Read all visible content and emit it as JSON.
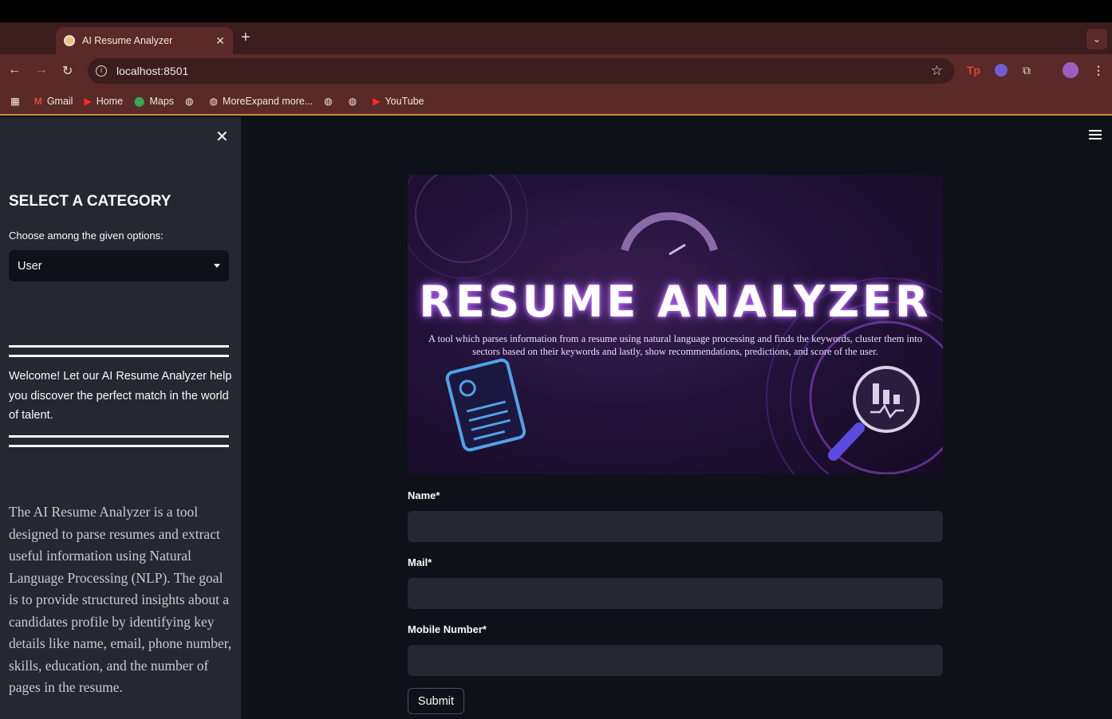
{
  "browser": {
    "tab_title": "AI Resume Analyzer",
    "url": "localhost:8501",
    "bookmarks": [
      {
        "label": "Gmail",
        "icon": "gmail-icon"
      },
      {
        "label": "Home",
        "icon": "youtube-icon"
      },
      {
        "label": "Maps",
        "icon": "maps-icon"
      },
      {
        "label": "",
        "icon": "globe-icon"
      },
      {
        "label": "MoreExpand more...",
        "icon": "globe-icon"
      },
      {
        "label": "",
        "icon": "globe-icon"
      },
      {
        "label": "",
        "icon": "globe-icon"
      },
      {
        "label": "YouTube",
        "icon": "youtube-icon"
      }
    ]
  },
  "sidebar": {
    "heading": "SELECT A CATEGORY",
    "choose_label": "Choose among the given options:",
    "selected_option": "User",
    "welcome_text": "Welcome! Let our AI Resume Analyzer help you discover the perfect match in the world of talent.",
    "about_text": "The AI Resume Analyzer is a tool designed to parse resumes and extract useful information using Natural Language Processing (NLP). The goal is to provide structured insights about a candidates profile by identifying key details like name, email, phone number, skills, education, and the number of pages in the resume."
  },
  "banner": {
    "title": "RESUME ANALYZER",
    "description": "A tool which parses information from a resume using natural language processing and finds the keywords, cluster them into sectors based on their keywords and lastly, show recommendations, predictions, and score of the user."
  },
  "form": {
    "name_label": "Name*",
    "name_value": "",
    "mail_label": "Mail*",
    "mail_value": "",
    "mobile_label": "Mobile Number*",
    "mobile_value": "",
    "submit_label": "Submit"
  },
  "colors": {
    "sidebar_bg": "#262730",
    "main_bg": "#0e1117",
    "browser_chrome": "#5a2a28"
  }
}
